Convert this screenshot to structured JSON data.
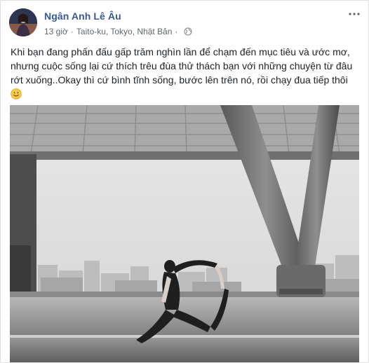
{
  "post": {
    "author": "Ngân Anh Lê Âu",
    "time": "13 giờ",
    "separator": "·",
    "location": "Taito-ku, Tokyo, Nhật Bản",
    "privacy_icon": "globe-icon",
    "more_icon": "more-options-icon",
    "text_lines": [
      "Khi bạn đang phấn đấu gấp trăm nghìn lần để chạm đến mục tiêu và ước mơ,",
      "nhưng cuộc sống lại cứ thích trêu đùa thử thách bạn với những chuyện từ đâu",
      "rớt xuống..Okay thì cứ bình tĩnh sống, bước lên trên nó, rồi chạy đua tiếp thôi"
    ],
    "emoji_icon": "smile-emoji-icon",
    "photo_icon": "rooftop-yoga-photo"
  },
  "colors": {
    "author_link": "#385898",
    "meta_text": "#616770",
    "body_text": "#1d2129",
    "card_border": "#dddfe2",
    "page_bg": "#e9ebee"
  }
}
